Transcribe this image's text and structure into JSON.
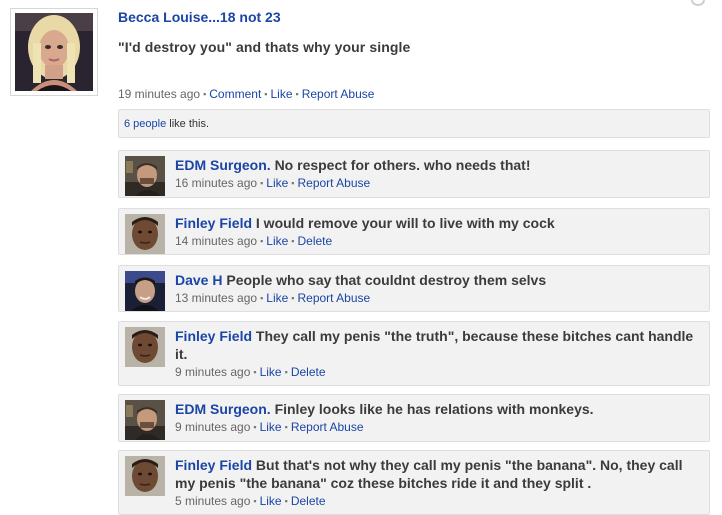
{
  "post": {
    "author": "Becca Louise...18 not 23",
    "text": "\"I'd destroy you\" and thats why your single",
    "time": "19 minutes ago",
    "comment_label": "Comment",
    "like_label": "Like",
    "report_label": "Report Abuse"
  },
  "likes": {
    "count_link": "6 people",
    "suffix": " like this."
  },
  "comments": [
    {
      "name": "EDM Surgeon.",
      "text": "No respect for others. who needs that!",
      "time": "16 minutes ago",
      "like": "Like",
      "action": "Report Abuse"
    },
    {
      "name": "Finley Field",
      "text": "I would remove your will to live with my cock",
      "time": "14 minutes ago",
      "like": "Like",
      "action": "Delete"
    },
    {
      "name": "Dave H",
      "text": "People who say that couldnt destroy them selvs",
      "time": "13 minutes ago",
      "like": "Like",
      "action": "Report Abuse"
    },
    {
      "name": "Finley Field",
      "text": "They call my penis \"the truth\", because these bitches cant handle it.",
      "time": "9 minutes ago",
      "like": "Like",
      "action": "Delete"
    },
    {
      "name": "EDM Surgeon.",
      "text": "Finley looks like he has relations with monkeys.",
      "time": "9 minutes ago",
      "like": "Like",
      "action": "Report Abuse"
    },
    {
      "name": "Finley Field",
      "text": "But that's not why they call my penis \"the banana\". No, they call my penis \"the banana\" coz these bitches ride it and they split .",
      "time": "5 minutes ago",
      "like": "Like",
      "action": "Delete"
    }
  ],
  "separator": "▪"
}
